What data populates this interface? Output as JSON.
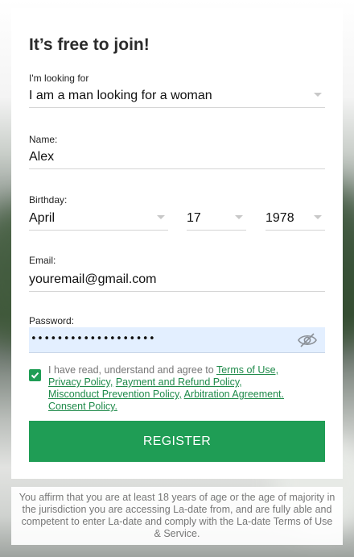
{
  "form": {
    "title": "It’s free to join!",
    "looking_for": {
      "label": "I'm looking for",
      "value": "I am a man looking for a woman"
    },
    "name": {
      "label": "Name:",
      "value": "Alex"
    },
    "birthday": {
      "label": "Birthday:",
      "month": "April",
      "day": "17",
      "year": "1978"
    },
    "email": {
      "label": "Email:",
      "value": "youremail@gmail.com"
    },
    "password": {
      "label": "Password:",
      "masked_value": "•••••••••••••••••••"
    },
    "agreement": {
      "checked": true,
      "prefix": "I have read, understand and agree to ",
      "links": [
        "Terms of Use,",
        "Privacy Policy,",
        "Payment and Refund Policy,",
        "Misconduct Prevention Policy,",
        "Arbitration Agreement.",
        "Consent Policy."
      ]
    },
    "register_label": "REGISTER"
  },
  "footer": {
    "text": "You affirm that you are at least 18 years of age or the age of majority in the jurisdiction you are accessing La-date from, and are fully able and competent to enter La-date and comply with the La-date Terms of Use & Service."
  },
  "colors": {
    "accent": "#1f9d55",
    "link": "#1f8a4a",
    "autofill_bg": "#e3efff"
  }
}
